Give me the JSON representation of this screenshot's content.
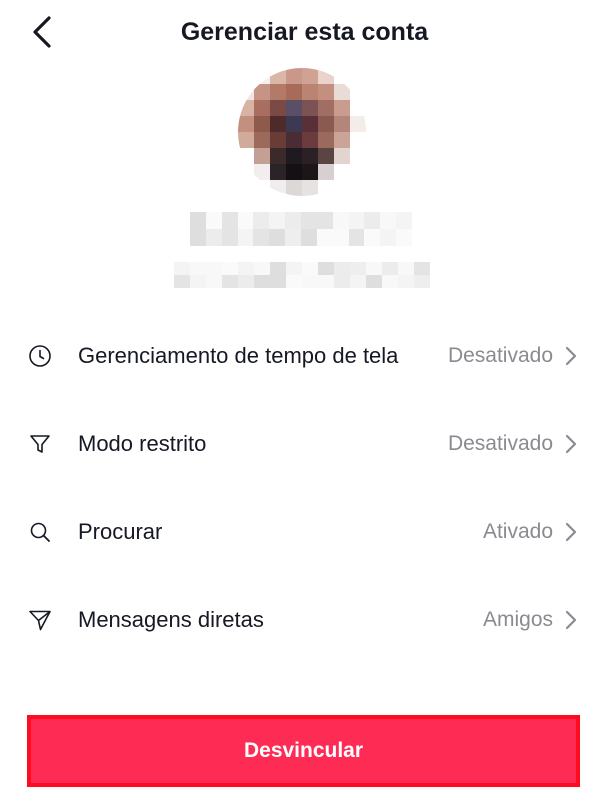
{
  "header": {
    "title": "Gerenciar esta conta",
    "back_icon": "chevron-left-icon"
  },
  "settings": [
    {
      "label": "Gerenciamento de tempo de tela",
      "value": "Desativado",
      "icon": "clock-icon"
    },
    {
      "label": "Modo restrito",
      "value": "Desativado",
      "icon": "filter-icon"
    },
    {
      "label": "Procurar",
      "value": "Ativado",
      "icon": "search-icon"
    },
    {
      "label": "Mensagens diretas",
      "value": "Amigos",
      "icon": "send-icon"
    }
  ],
  "actions": {
    "unlink_label": "Desvincular"
  },
  "colors": {
    "accent": "#fe2c55",
    "value_text": "#8a8b91",
    "primary_text": "#161823",
    "highlight_border": "#ff0a1e"
  }
}
